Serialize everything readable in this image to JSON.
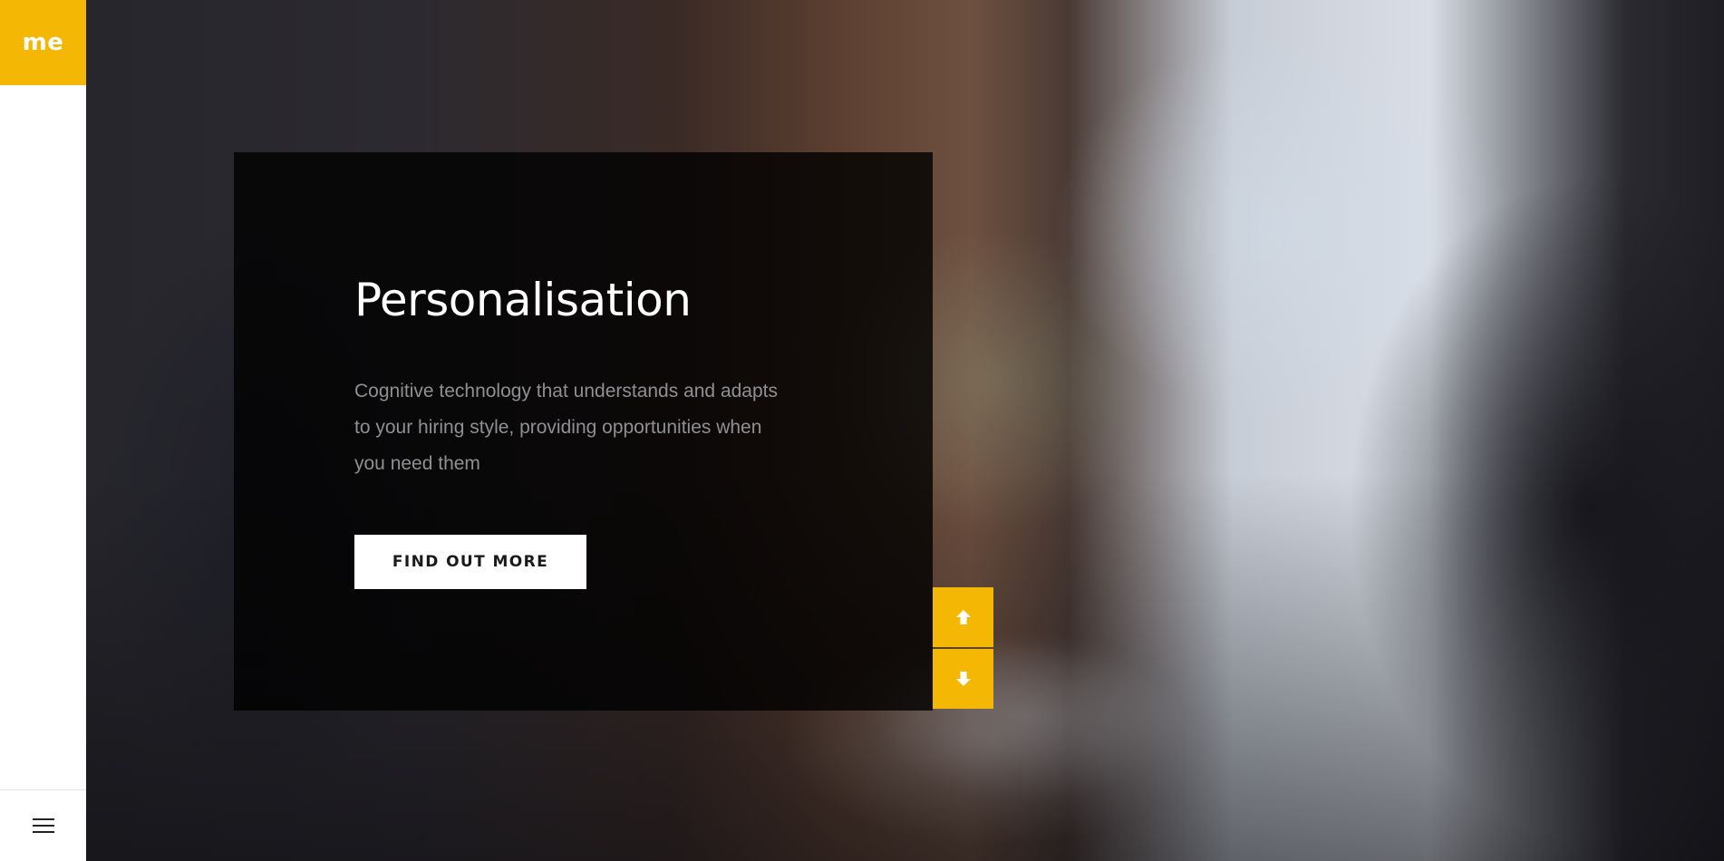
{
  "brand": {
    "logo_text": "me",
    "accent_color": "#f4b703"
  },
  "navigation": {
    "menu_icon": "hamburger-menu-icon"
  },
  "hero": {
    "title": "Personalisation",
    "description": "Cognitive technology that understands and adapts to your hiring style, providing opportunities when you need them",
    "cta_label": "FIND OUT MORE"
  },
  "slider": {
    "prev_icon": "arrow-up-icon",
    "next_icon": "arrow-down-icon"
  }
}
